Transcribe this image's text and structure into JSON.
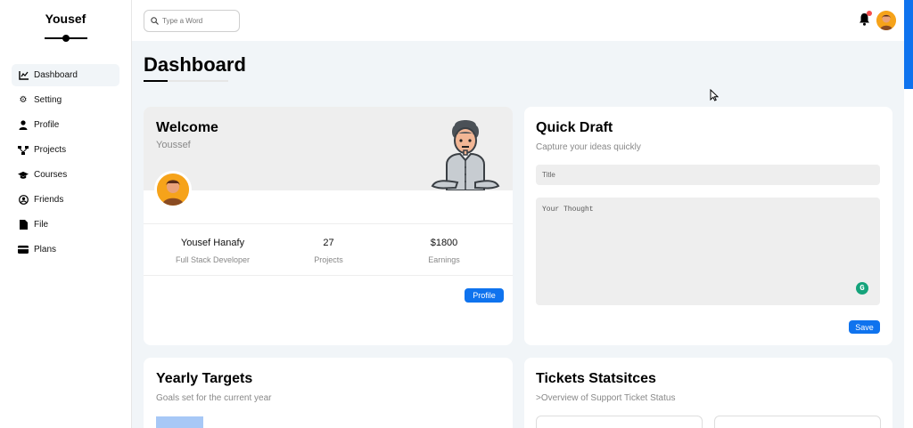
{
  "brand": {
    "name": "Yousef"
  },
  "sidebar": {
    "items": [
      {
        "label": "Dashboard",
        "icon": "chart-icon",
        "active": true
      },
      {
        "label": "Setting",
        "icon": "gear-icon"
      },
      {
        "label": "Profile",
        "icon": "user-icon"
      },
      {
        "label": "Projects",
        "icon": "diagram-icon"
      },
      {
        "label": "Courses",
        "icon": "graduation-cap-icon"
      },
      {
        "label": "Friends",
        "icon": "circle-user-icon"
      },
      {
        "label": "File",
        "icon": "file-icon"
      },
      {
        "label": "Plans",
        "icon": "credit-card-icon"
      }
    ]
  },
  "header": {
    "search": {
      "placeholder": "Type a Word"
    },
    "notifications": {
      "has_new": true
    }
  },
  "page": {
    "title": "Dashboard"
  },
  "welcome": {
    "title": "Welcome",
    "subtitle": "Youssef",
    "stats": [
      {
        "value": "Yousef Hanafy",
        "label": "Full Stack Developer"
      },
      {
        "value": "27",
        "label": "Projects"
      },
      {
        "value": "$1800",
        "label": "Earnings"
      }
    ],
    "profile_button": "Profile"
  },
  "quick_draft": {
    "title": "Quick Draft",
    "subtitle": "Capture your ideas quickly",
    "title_placeholder": "Title",
    "body_placeholder": "Your Thought",
    "save_button": "Save"
  },
  "yearly_targets": {
    "title": "Yearly Targets",
    "subtitle": "Goals set for the current year"
  },
  "tickets": {
    "title": "Tickets Statsitces",
    "subtitle": ">Overview of Support Ticket Status"
  },
  "colors": {
    "accent": "#0f73ee",
    "notification": "#f34c4c",
    "grammarly": "#15a37b"
  }
}
